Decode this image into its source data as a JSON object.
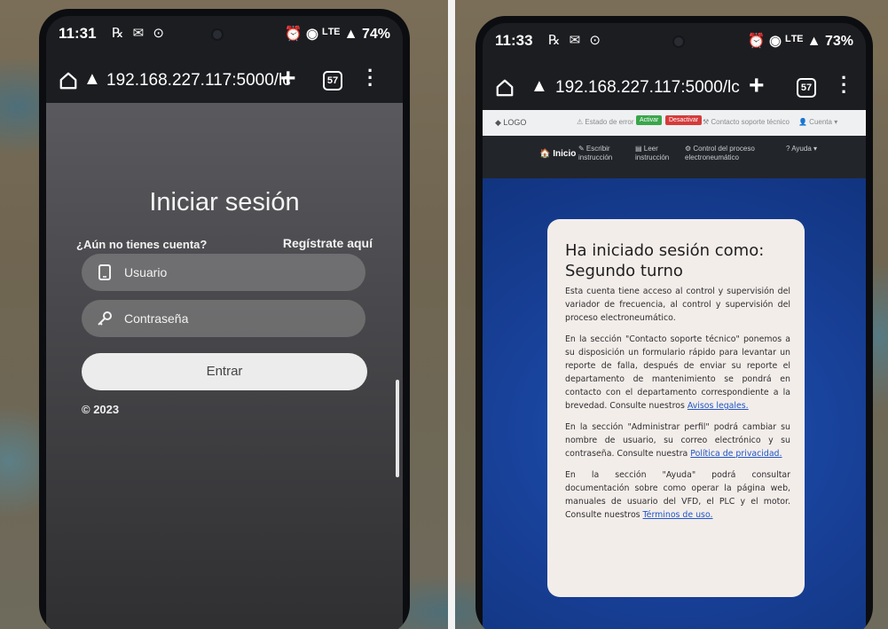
{
  "left_phone": {
    "status": {
      "time": "11:31",
      "battery": "74%",
      "left_icons": "℞ ✉ ⊙",
      "right_icons": "⏰ ◉ ᴸᵀᴱ ▲"
    },
    "browser": {
      "url": "192.168.227.117:5000/lc",
      "tab_count": "57"
    },
    "login": {
      "title": "Iniciar sesión",
      "no_account": "¿Aún no tienes cuenta?",
      "register_link": "Regístrate aquí",
      "username_placeholder": "Usuario",
      "password_placeholder": "Contraseña",
      "submit": "Entrar",
      "footer": "© 2023"
    }
  },
  "right_phone": {
    "status": {
      "time": "11:33",
      "battery": "73%",
      "left_icons": "℞ ✉ ⊙",
      "right_icons": "⏰ ◉ ᴸᵀᴱ ▲"
    },
    "browser": {
      "url": "192.168.227.117:5000/lc",
      "tab_count": "57"
    },
    "topnav": {
      "logo": "◆ LOGO",
      "estado": "⚠ Estado de error",
      "activar": "Activar",
      "desactivar": "Desactivar",
      "contacto": "⚒ Contacto soporte técnico",
      "cuenta": "👤 Cuenta ▾"
    },
    "mainnav": {
      "inicio": "🏠 Inicio",
      "escribir": "✎ Escribir instrucción",
      "leer": "▤ Leer instrucción",
      "control": "⚙ Control del proceso electroneumático",
      "ayuda": "? Ayuda ▾"
    },
    "card": {
      "title": "Ha iniciado sesión como: Segundo turno",
      "p1": "Esta cuenta tiene acceso al control y supervisión del variador de frecuencia, al control y supervisión del proceso electroneumático.",
      "p2": "En la sección \"Contacto soporte técnico\" ponemos a su disposición un formulario rápido para levantar un reporte de falla, después de enviar su reporte el departamento de mantenimiento se pondrá en contacto con el departamento correspondiente a la brevedad. Consulte nuestros",
      "p2_link": "Avisos legales.",
      "p3": "En la sección \"Administrar perfil\" podrá cambiar su nombre de usuario, su correo electrónico y su contraseña. Consulte nuestra",
      "p3_link": "Política de privacidad.",
      "p4": "En la sección \"Ayuda\" podrá consultar documentación sobre como operar la página web, manuales de usuario del VFD, el PLC y el motor. Consulte nuestros",
      "p4_link": "Términos de uso."
    }
  }
}
